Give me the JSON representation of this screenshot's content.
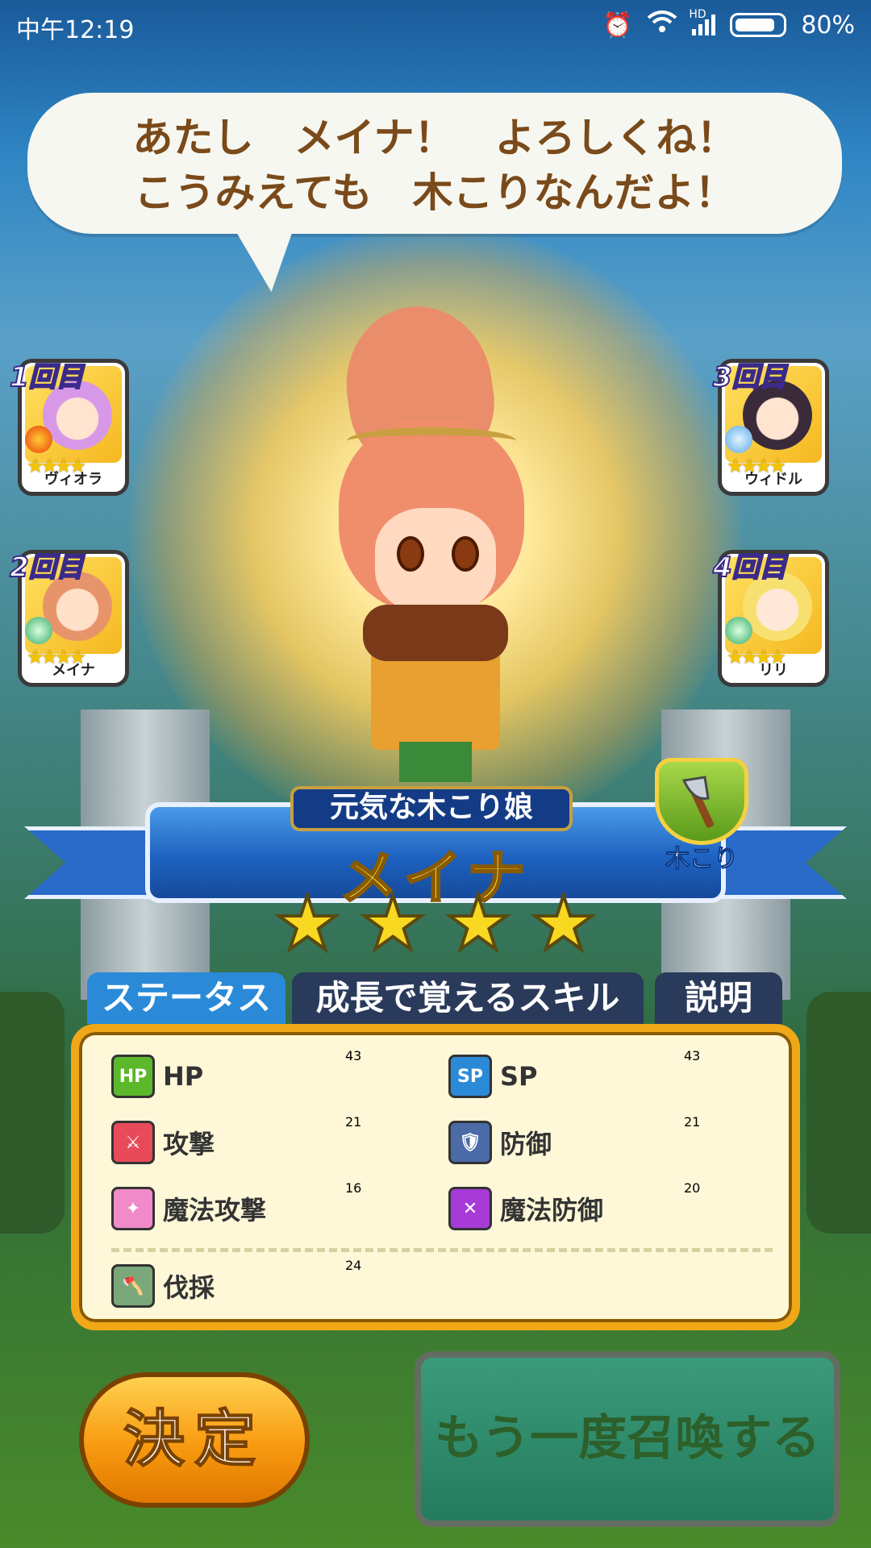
{
  "status_bar": {
    "time": "中午12:19",
    "battery": "80%",
    "signal_label": "HD"
  },
  "speech": {
    "line1": "あたし　メイナ！　よろしくね！",
    "line2": "こうみえても　木こりなんだよ！"
  },
  "summons": [
    {
      "badge": "1回目",
      "name": "ヴィオラ",
      "stars": "★★★★"
    },
    {
      "badge": "2回目",
      "name": "メイナ",
      "stars": "★★★★"
    },
    {
      "badge": "3回目",
      "name": "ウィドル",
      "stars": "★★★★"
    },
    {
      "badge": "4回目",
      "name": "リリ",
      "stars": "★★★★"
    }
  ],
  "character": {
    "subtitle": "元気な木こり娘",
    "name": "メイナ",
    "rarity": 4,
    "job": "木こり"
  },
  "tabs": [
    {
      "label": "ステータス",
      "active": true
    },
    {
      "label": "成長で覚えるスキル",
      "active": false
    },
    {
      "label": "説明",
      "active": false
    }
  ],
  "stats": {
    "hp": {
      "label": "HP",
      "icon_text": "HP",
      "value": "43"
    },
    "sp": {
      "label": "SP",
      "icon_text": "SP",
      "value": "43"
    },
    "attack": {
      "label": "攻撃",
      "value": "21"
    },
    "defense": {
      "label": "防御",
      "value": "21"
    },
    "magic_attack": {
      "label": "魔法攻撃",
      "value": "16"
    },
    "magic_defense": {
      "label": "魔法防御",
      "value": "20"
    },
    "logging": {
      "label": "伐採",
      "value": "24"
    }
  },
  "buttons": {
    "decide": "決定",
    "summon_again": "もう一度召喚する"
  },
  "colors": {
    "accent_orange": "#f89a10",
    "ribbon_blue": "#1e62c0",
    "panel_bg": "#fff8d8",
    "star_yellow": "#f8d820"
  }
}
